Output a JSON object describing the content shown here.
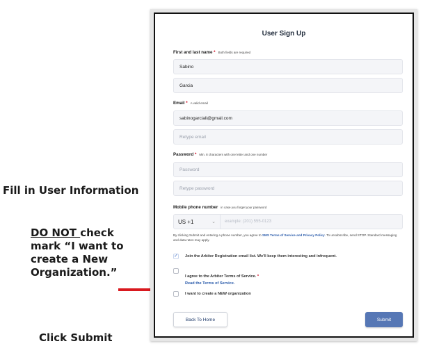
{
  "annotations": {
    "fill_in": "Fill in User Information",
    "do_not_prefix": "DO NOT ",
    "do_not_rest": "check mark “I want to create a New Organization.”",
    "click_submit": "Click Submit"
  },
  "form": {
    "title": "User Sign Up",
    "name": {
      "label": "First and last name",
      "required_mark": "*",
      "hint": "Both fields are required",
      "first_value": "Sabino",
      "last_value": "Garcia"
    },
    "email": {
      "label": "Email",
      "required_mark": "*",
      "hint": "A valid email",
      "value": "sabinogarciali@gmail.com",
      "retype_placeholder": "Retype email"
    },
    "password": {
      "label": "Password",
      "required_mark": "*",
      "hint": "Min. 8 characters with one letter and one number",
      "placeholder": "Password",
      "retype_placeholder": "Retype password"
    },
    "phone": {
      "label": "Mobile phone number",
      "hint": "in case you forget your password",
      "country_code": "US +1",
      "placeholder": "example: (201) 555-0123"
    },
    "disclaimer": {
      "before": "By clicking Submit and entering a phone number, you agree to ",
      "link": "SMS Terms of Service and Privacy Policy",
      "after": ". To unsubscribe, send STOP. Standard messaging and data rates may apply."
    },
    "checkboxes": [
      {
        "label": "Join the Arbiter Registration email list. We'll keep them interesting and infrequent.",
        "checked": true
      },
      {
        "label": "I agree to the Arbiter Terms of Service.",
        "required_mark": "*",
        "link": "Read the Terms of Service.",
        "checked": false
      },
      {
        "label": "I want to create a NEW organization",
        "checked": false
      }
    ],
    "back_button": "Back To Home",
    "submit_button": "Submit"
  },
  "colors": {
    "arrow": "#d9191f",
    "submit": "#5677b5",
    "link": "#2b5cab",
    "required": "#d0021b"
  }
}
